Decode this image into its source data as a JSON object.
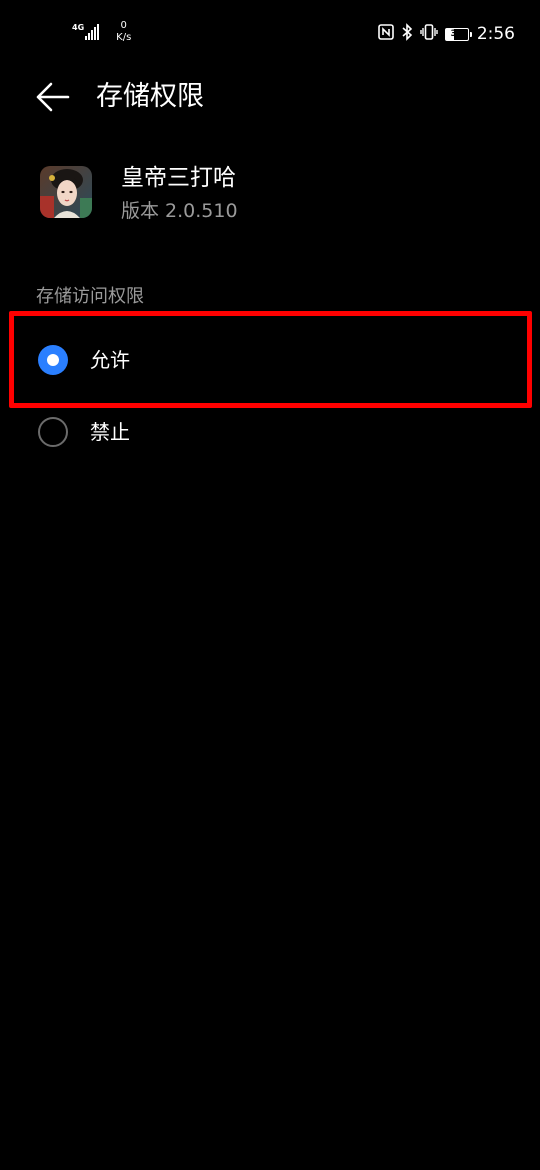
{
  "status_bar": {
    "network_type": "4G",
    "network_speed_value": "0",
    "network_speed_unit": "K/s",
    "battery_level": "37",
    "battery_fraction": 0.37,
    "time": "2:56"
  },
  "header": {
    "title": "存储权限"
  },
  "app": {
    "name": "皇帝三打哈",
    "version": "版本 2.0.510"
  },
  "permission": {
    "section_label": "存储访问权限",
    "options": [
      {
        "label": "允许",
        "selected": true
      },
      {
        "label": "禁止",
        "selected": false
      }
    ]
  },
  "colors": {
    "background": "#000000",
    "accent": "#2a7fff",
    "secondary_text": "#9a9a9a",
    "highlight": "#ff0000"
  }
}
